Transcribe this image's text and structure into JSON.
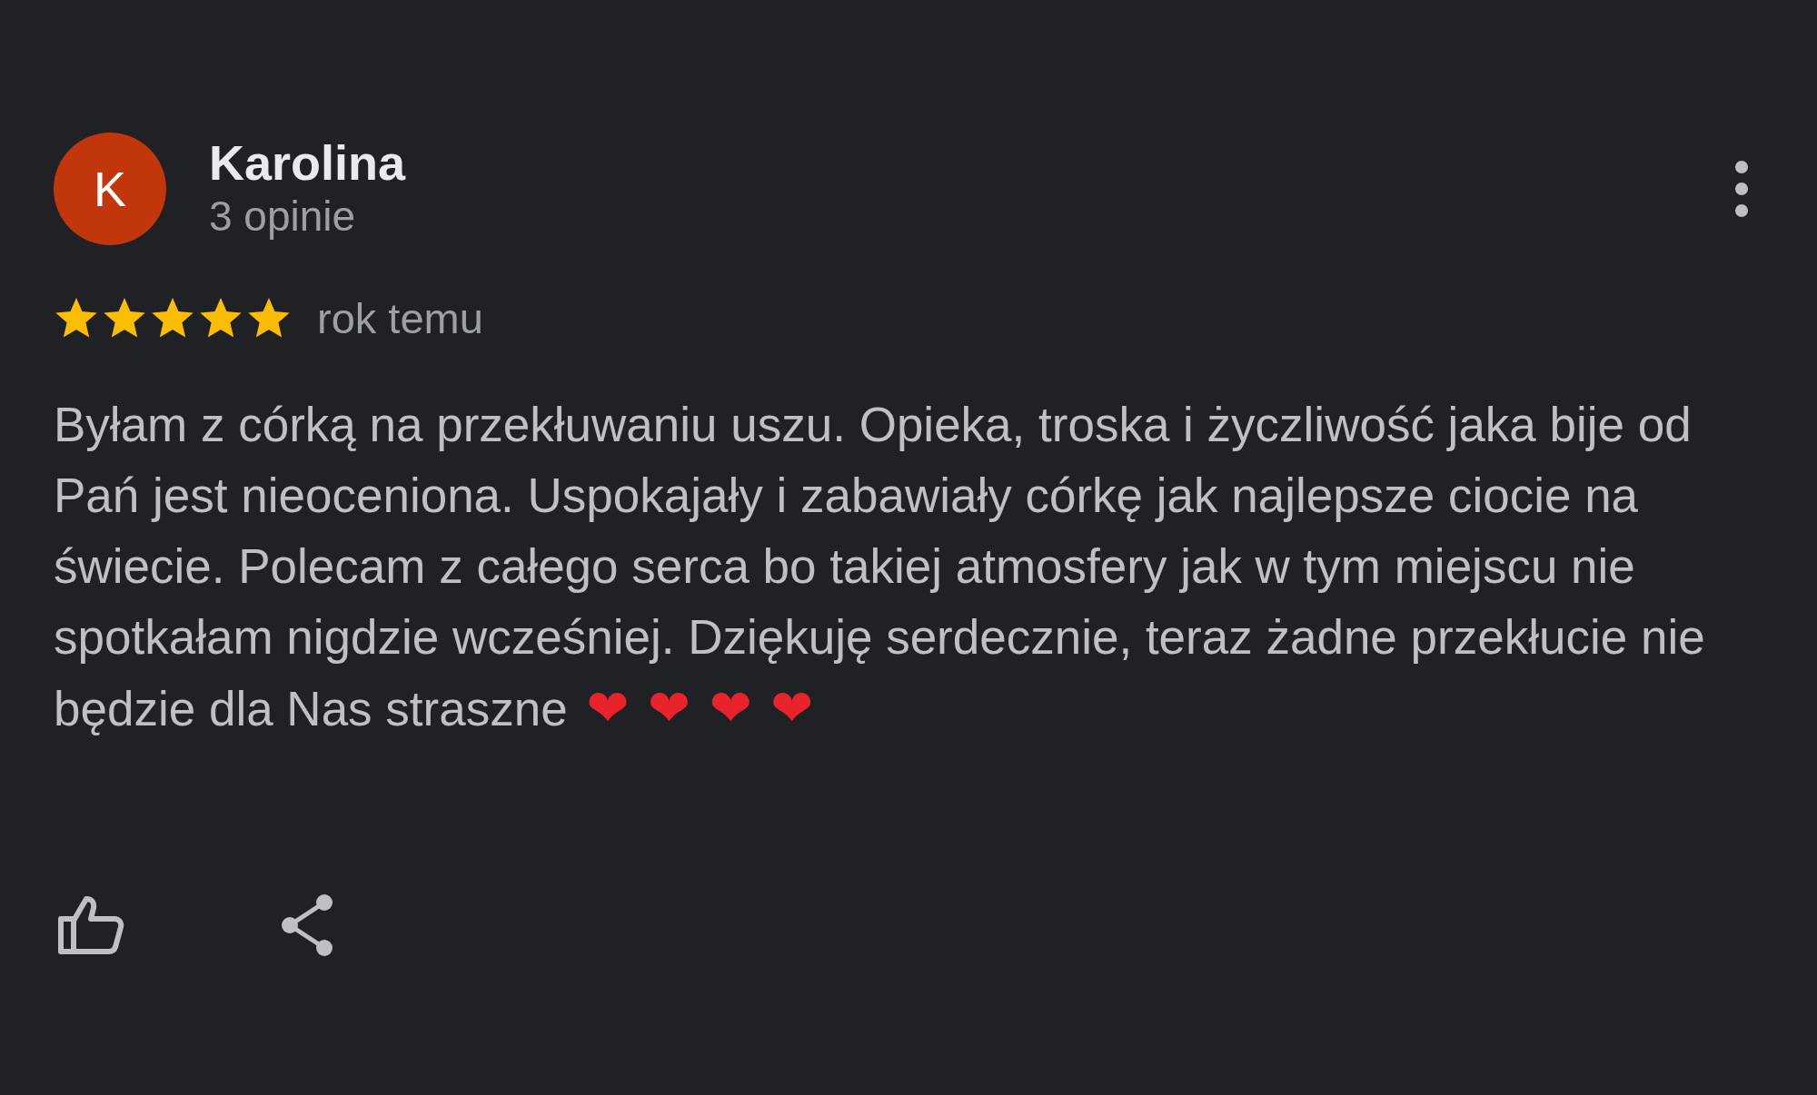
{
  "review": {
    "avatar_letter": "K",
    "author": "Karolina",
    "author_meta": "3 opinie",
    "stars": 5,
    "time": "rok temu",
    "text": "Byłam z córką na przekłuwaniu uszu. Opieka, troska i życzliwość jaka bije od Pań jest nieoceniona. Uspokajały i zabawiały córkę jak najlepsze ciocie na świecie. Polecam z całego serca bo takiej atmosfery jak w tym miejscu nie spotkałam nigdzie wcześniej. Dziękuję serdecznie, teraz żadne przekłucie nie będzie dla Nas straszne",
    "emoji": [
      "❤",
      "❤",
      "❤",
      "❤"
    ]
  }
}
